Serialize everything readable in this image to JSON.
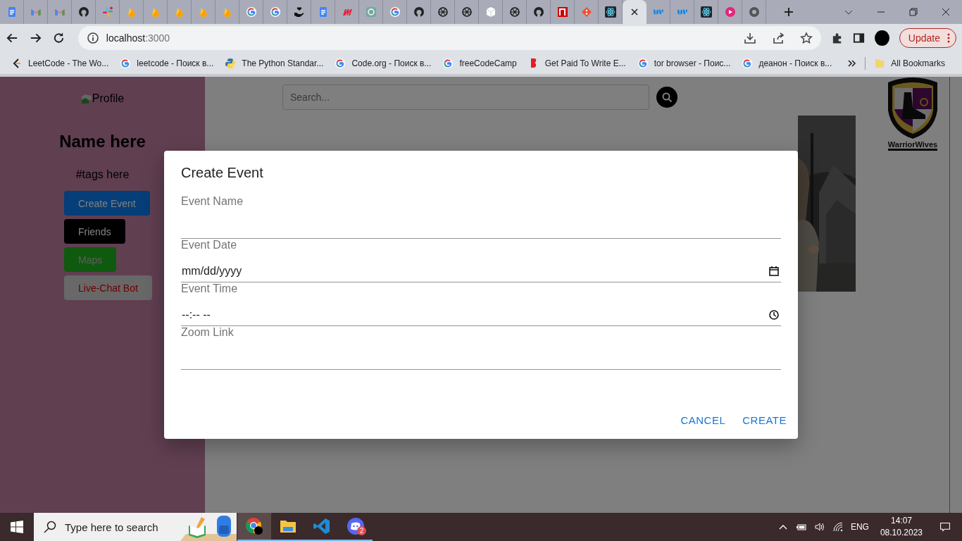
{
  "browser": {
    "tabs": [
      {
        "kind": "docs",
        "selected": false
      },
      {
        "kind": "gmail",
        "selected": false
      },
      {
        "kind": "gmail",
        "selected": false
      },
      {
        "kind": "github",
        "selected": false
      },
      {
        "kind": "slack",
        "selected": false
      },
      {
        "kind": "firebase",
        "selected": false
      },
      {
        "kind": "firebase",
        "selected": false
      },
      {
        "kind": "firebase",
        "selected": false
      },
      {
        "kind": "firebase",
        "selected": false
      },
      {
        "kind": "firebase",
        "selected": false
      },
      {
        "kind": "google",
        "selected": false
      },
      {
        "kind": "google",
        "selected": false
      },
      {
        "kind": "charity",
        "selected": false
      },
      {
        "kind": "docs",
        "selected": false
      },
      {
        "kind": "miro",
        "selected": false
      },
      {
        "kind": "chatgpt",
        "selected": false
      },
      {
        "kind": "google",
        "selected": false
      },
      {
        "kind": "github",
        "selected": false
      },
      {
        "kind": "openai",
        "selected": false
      },
      {
        "kind": "openai",
        "selected": false
      },
      {
        "kind": "cube",
        "selected": false
      },
      {
        "kind": "openai",
        "selected": false
      },
      {
        "kind": "github",
        "selected": false
      },
      {
        "kind": "redsquare",
        "selected": false
      },
      {
        "kind": "git",
        "selected": false
      },
      {
        "kind": "react",
        "selected": false
      },
      {
        "kind": "page",
        "selected": true
      },
      {
        "kind": "mui",
        "selected": false
      },
      {
        "kind": "mui",
        "selected": false
      },
      {
        "kind": "react",
        "selected": false
      },
      {
        "kind": "video",
        "selected": false
      },
      {
        "kind": "chrome",
        "selected": false
      }
    ],
    "address": {
      "host": "localhost",
      "port": ":3000"
    },
    "update_button": "Update",
    "bookmarks": [
      {
        "kind": "leetcode",
        "label": "LeetCode - The Wo..."
      },
      {
        "kind": "google",
        "label": "leetcode - Поиск в..."
      },
      {
        "kind": "python",
        "label": "The Python Standar..."
      },
      {
        "kind": "google",
        "label": "Code.org - Поиск в..."
      },
      {
        "kind": "google",
        "label": "freeCodeCamp"
      },
      {
        "kind": "blog",
        "label": "Get Paid To Write E..."
      },
      {
        "kind": "google",
        "label": "tor browser - Поис..."
      },
      {
        "kind": "google",
        "label": "деанон - Поиск в..."
      }
    ],
    "all_bookmarks": "All Bookmarks"
  },
  "sidebar": {
    "profile_alt": "Profile",
    "name": "Name here",
    "tags": "#tags here",
    "buttons": [
      {
        "kind": "primary",
        "label": "Create Event"
      },
      {
        "kind": "dark",
        "label": "Friends"
      },
      {
        "kind": "success",
        "label": "Maps"
      },
      {
        "kind": "light",
        "label": "Live-Chat Bot"
      }
    ]
  },
  "main": {
    "search": {
      "placeholder": "Search..."
    },
    "logo": {
      "text": "WarriorWives"
    }
  },
  "dialog": {
    "title": "Create Event",
    "fields": [
      {
        "kind": "text",
        "label": "Event Name"
      },
      {
        "kind": "date",
        "label": "Event Date",
        "placeholder": "mm/dd/yyyy"
      },
      {
        "kind": "time",
        "label": "Event Time",
        "placeholder": "--:-- --"
      },
      {
        "kind": "text",
        "label": "Zoom Link"
      }
    ],
    "actions": [
      "CANCEL",
      "CREATE"
    ]
  },
  "taskbar": {
    "search_placeholder": "Type here to search",
    "apps": [
      {
        "kind": "chrome",
        "selected": true
      },
      {
        "kind": "folder",
        "selected": false
      },
      {
        "kind": "vscode",
        "selected": false
      },
      {
        "kind": "discord",
        "selected": false,
        "badge": "2"
      }
    ],
    "language": "ENG",
    "time": "14:07",
    "date": "08.10.2023"
  }
}
